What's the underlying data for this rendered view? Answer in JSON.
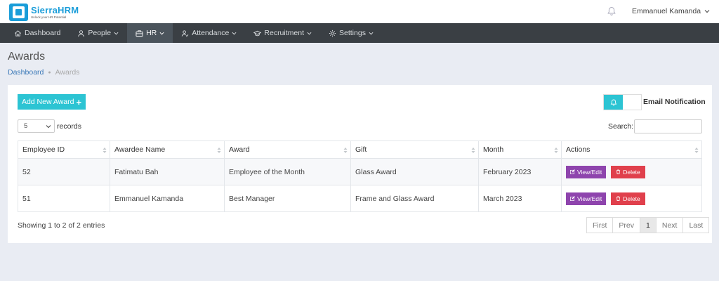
{
  "brand": {
    "name": "SierraHRM",
    "tagline": "Unlock your HR Potential"
  },
  "header": {
    "user_name": "Emmanuel Kamanda"
  },
  "nav": [
    {
      "label": "Dashboard",
      "icon": "home-icon",
      "has_menu": false,
      "active": false
    },
    {
      "label": "People",
      "icon": "user-icon",
      "has_menu": true,
      "active": false
    },
    {
      "label": "HR",
      "icon": "briefcase-icon",
      "has_menu": true,
      "active": true
    },
    {
      "label": "Attendance",
      "icon": "attendance-icon",
      "has_menu": true,
      "active": false
    },
    {
      "label": "Recruitment",
      "icon": "graduation-icon",
      "has_menu": true,
      "active": false
    },
    {
      "label": "Settings",
      "icon": "gear-icon",
      "has_menu": true,
      "active": false
    }
  ],
  "page": {
    "title": "Awards",
    "breadcrumb": {
      "home": "Dashboard",
      "current": "Awards"
    }
  },
  "toolbar": {
    "add_label": "Add New Award",
    "email_label": "Email Notification",
    "records_value": "5",
    "records_label": "records",
    "search_label": "Search:",
    "search_value": ""
  },
  "table": {
    "columns": [
      "Employee ID",
      "Awardee Name",
      "Award",
      "Gift",
      "Month",
      "Actions"
    ],
    "rows": [
      {
        "employee_id": "52",
        "name": "Fatimatu Bah",
        "award": "Employee of the Month",
        "gift": "Glass Award",
        "month": "February 2023"
      },
      {
        "employee_id": "51",
        "name": "Emmanuel Kamanda",
        "award": "Best Manager",
        "gift": "Frame and Glass Award",
        "month": "March 2023"
      }
    ],
    "edit_label": "View/Edit",
    "delete_label": "Delete"
  },
  "footer": {
    "info": "Showing 1 to 2 of 2 entries",
    "pager": [
      "First",
      "Prev",
      "1",
      "Next",
      "Last"
    ],
    "current_page": "1"
  },
  "colors": {
    "accent": "#2cc4d3",
    "nav_bg": "#3a3f44",
    "edit": "#8e44ad",
    "delete": "#e0404c"
  }
}
